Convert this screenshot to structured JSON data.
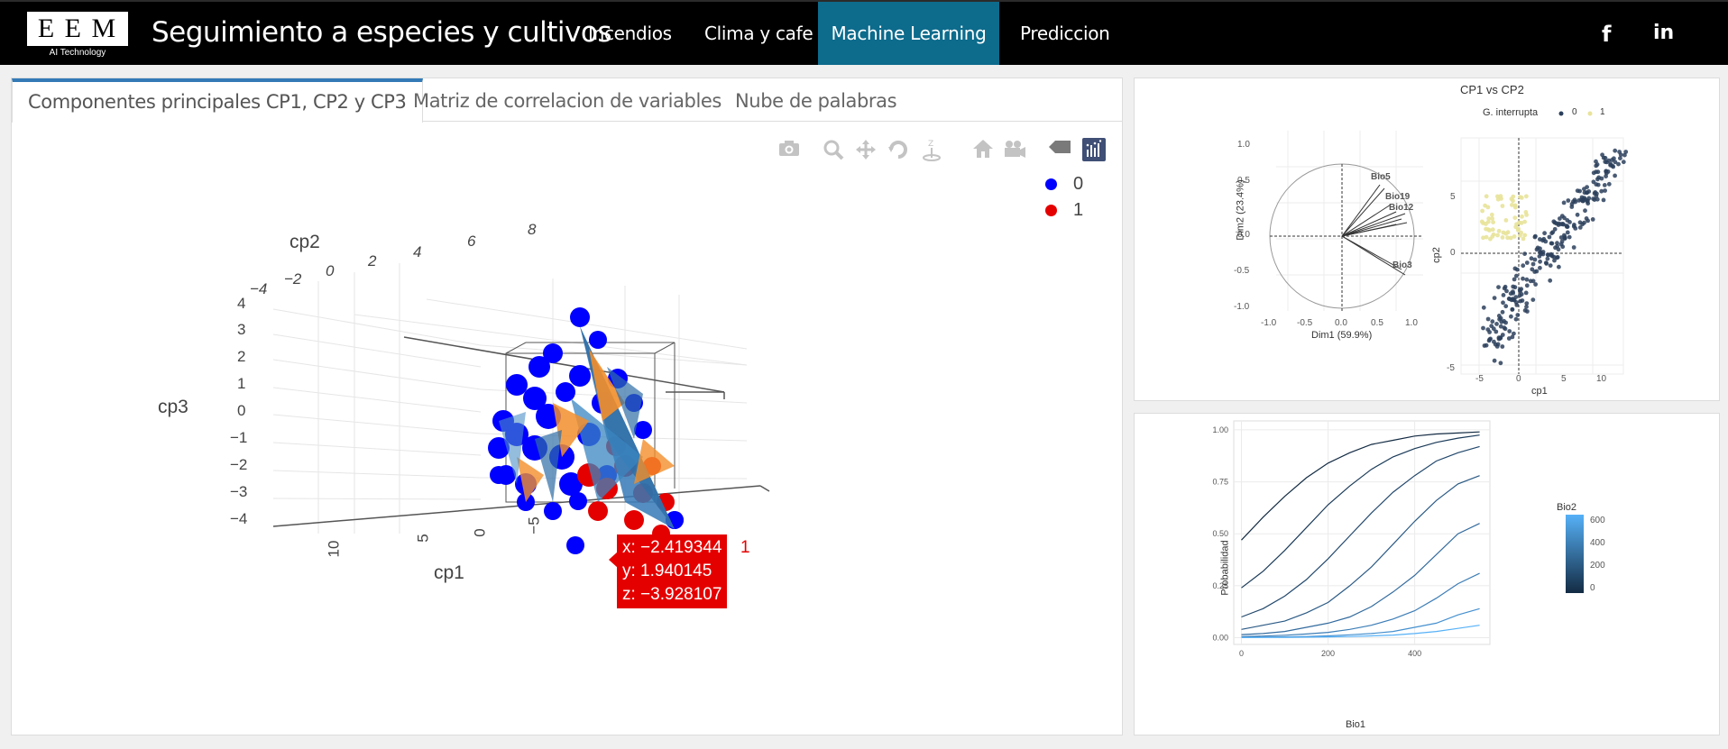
{
  "navbar": {
    "logo_letters": "E E M",
    "logo_sub": "AI Technology",
    "brand": "Seguimiento a especies y cultivos",
    "items": [
      {
        "label": "Incendios"
      },
      {
        "label": "Clima y cafe"
      },
      {
        "label": "Machine Learning"
      },
      {
        "label": "Prediccion"
      }
    ],
    "active_item": "Machine Learning",
    "social": {
      "facebook": "f",
      "linkedin": "in"
    },
    "active_color": "#0d6b8c"
  },
  "tabs": [
    {
      "label": "Componentes principales CP1, CP2 y CP3"
    },
    {
      "label": "Matriz de correlacion de variables"
    },
    {
      "label": "Nube de palabras"
    }
  ],
  "modebar": [
    "camera-icon",
    "zoom-icon",
    "pan-icon",
    "orbit-icon",
    "turntable-icon",
    "home-icon",
    "camera-view-icon",
    "hover-tag-icon",
    "plotly-logo-icon"
  ],
  "plot3d": {
    "legend": [
      {
        "label": "0",
        "color": "#0000ff"
      },
      {
        "label": "1",
        "color": "#e50000"
      }
    ],
    "axes": {
      "x_title": "cp1",
      "y_title": "cp2",
      "z_title": "cp3",
      "x_ticks": [
        "10",
        "5",
        "0",
        "−5"
      ],
      "y_ticks": [
        "−4",
        "−2",
        "0",
        "2",
        "4",
        "6",
        "8"
      ],
      "z_ticks": [
        "4",
        "3",
        "2",
        "1",
        "0",
        "−1",
        "−2",
        "−3",
        "−4"
      ]
    },
    "hover": {
      "x": "x: −2.419344",
      "y": "y: 1.940145",
      "z": "z: −3.928107",
      "trace": "1"
    }
  },
  "pca_chart": {
    "title": "CP1 vs CP2",
    "legend_title": "G. interrupta",
    "legend": [
      {
        "label": "0",
        "color": "#2b3f5c"
      },
      {
        "label": "1",
        "color": "#e8e39a"
      }
    ],
    "circle_plot": {
      "xlabel": "Dim1 (59.9%)",
      "ylabel": "Dim2 (23.4%)",
      "x_ticks": [
        "-1.0",
        "-0.5",
        "0.0",
        "0.5",
        "1.0"
      ],
      "y_ticks": [
        "1.0",
        "0.5",
        "0.0",
        "-0.5",
        "-1.0"
      ],
      "variable_labels": [
        "Bio5",
        "Bio19",
        "Bio12",
        "Bio3"
      ]
    },
    "scatter": {
      "xlabel": "cp1",
      "ylabel": "cp2",
      "x_ticks": [
        "-5",
        "0",
        "5",
        "10"
      ],
      "y_ticks": [
        "5",
        "0",
        "-5"
      ]
    }
  },
  "chart_data": {
    "type": "line",
    "title": "",
    "xlabel": "Bio1",
    "ylabel": "Probabilidad",
    "xlim": [
      0,
      550
    ],
    "ylim": [
      0,
      1
    ],
    "x_ticks": [
      "0",
      "200",
      "400"
    ],
    "y_ticks": [
      "0.00",
      "0.25",
      "0.50",
      "0.75",
      "1.00"
    ],
    "legend_title": "Bio2",
    "legend_ticks": [
      "600",
      "400",
      "200",
      "0"
    ],
    "x": [
      0,
      50,
      100,
      150,
      200,
      250,
      300,
      350,
      400,
      450,
      500,
      550
    ],
    "series": [
      {
        "values": [
          0.47,
          0.58,
          0.68,
          0.77,
          0.84,
          0.89,
          0.93,
          0.95,
          0.97,
          0.98,
          0.985,
          0.99
        ],
        "color": "#132b43"
      },
      {
        "values": [
          0.24,
          0.32,
          0.42,
          0.53,
          0.64,
          0.73,
          0.81,
          0.87,
          0.91,
          0.94,
          0.96,
          0.975
        ],
        "color": "#1a3a58"
      },
      {
        "values": [
          0.1,
          0.14,
          0.2,
          0.28,
          0.38,
          0.49,
          0.6,
          0.7,
          0.78,
          0.85,
          0.89,
          0.92
        ],
        "color": "#22486c"
      },
      {
        "values": [
          0.04,
          0.06,
          0.08,
          0.12,
          0.17,
          0.25,
          0.34,
          0.45,
          0.56,
          0.66,
          0.74,
          0.78
        ],
        "color": "#2b5a85"
      },
      {
        "values": [
          0.015,
          0.02,
          0.03,
          0.05,
          0.07,
          0.1,
          0.15,
          0.22,
          0.3,
          0.4,
          0.5,
          0.55
        ],
        "color": "#336b9e"
      },
      {
        "values": [
          0.005,
          0.008,
          0.012,
          0.018,
          0.026,
          0.04,
          0.06,
          0.09,
          0.13,
          0.19,
          0.26,
          0.31
        ],
        "color": "#3c7db6"
      },
      {
        "values": [
          0.002,
          0.003,
          0.004,
          0.006,
          0.009,
          0.014,
          0.02,
          0.03,
          0.05,
          0.07,
          0.11,
          0.14
        ],
        "color": "#4590cf"
      },
      {
        "values": [
          0.001,
          0.001,
          0.002,
          0.003,
          0.004,
          0.006,
          0.009,
          0.013,
          0.02,
          0.03,
          0.045,
          0.06
        ],
        "color": "#56b1f7"
      }
    ]
  }
}
